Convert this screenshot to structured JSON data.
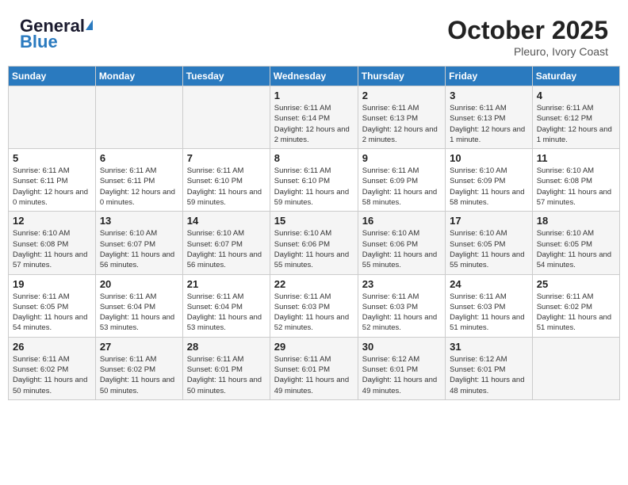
{
  "header": {
    "logo_general": "General",
    "logo_blue": "Blue",
    "month": "October 2025",
    "location": "Pleuro, Ivory Coast"
  },
  "weekdays": [
    "Sunday",
    "Monday",
    "Tuesday",
    "Wednesday",
    "Thursday",
    "Friday",
    "Saturday"
  ],
  "weeks": [
    [
      {
        "day": "",
        "info": ""
      },
      {
        "day": "",
        "info": ""
      },
      {
        "day": "",
        "info": ""
      },
      {
        "day": "1",
        "info": "Sunrise: 6:11 AM\nSunset: 6:14 PM\nDaylight: 12 hours and 2 minutes."
      },
      {
        "day": "2",
        "info": "Sunrise: 6:11 AM\nSunset: 6:13 PM\nDaylight: 12 hours and 2 minutes."
      },
      {
        "day": "3",
        "info": "Sunrise: 6:11 AM\nSunset: 6:13 PM\nDaylight: 12 hours and 1 minute."
      },
      {
        "day": "4",
        "info": "Sunrise: 6:11 AM\nSunset: 6:12 PM\nDaylight: 12 hours and 1 minute."
      }
    ],
    [
      {
        "day": "5",
        "info": "Sunrise: 6:11 AM\nSunset: 6:11 PM\nDaylight: 12 hours and 0 minutes."
      },
      {
        "day": "6",
        "info": "Sunrise: 6:11 AM\nSunset: 6:11 PM\nDaylight: 12 hours and 0 minutes."
      },
      {
        "day": "7",
        "info": "Sunrise: 6:11 AM\nSunset: 6:10 PM\nDaylight: 11 hours and 59 minutes."
      },
      {
        "day": "8",
        "info": "Sunrise: 6:11 AM\nSunset: 6:10 PM\nDaylight: 11 hours and 59 minutes."
      },
      {
        "day": "9",
        "info": "Sunrise: 6:11 AM\nSunset: 6:09 PM\nDaylight: 11 hours and 58 minutes."
      },
      {
        "day": "10",
        "info": "Sunrise: 6:10 AM\nSunset: 6:09 PM\nDaylight: 11 hours and 58 minutes."
      },
      {
        "day": "11",
        "info": "Sunrise: 6:10 AM\nSunset: 6:08 PM\nDaylight: 11 hours and 57 minutes."
      }
    ],
    [
      {
        "day": "12",
        "info": "Sunrise: 6:10 AM\nSunset: 6:08 PM\nDaylight: 11 hours and 57 minutes."
      },
      {
        "day": "13",
        "info": "Sunrise: 6:10 AM\nSunset: 6:07 PM\nDaylight: 11 hours and 56 minutes."
      },
      {
        "day": "14",
        "info": "Sunrise: 6:10 AM\nSunset: 6:07 PM\nDaylight: 11 hours and 56 minutes."
      },
      {
        "day": "15",
        "info": "Sunrise: 6:10 AM\nSunset: 6:06 PM\nDaylight: 11 hours and 55 minutes."
      },
      {
        "day": "16",
        "info": "Sunrise: 6:10 AM\nSunset: 6:06 PM\nDaylight: 11 hours and 55 minutes."
      },
      {
        "day": "17",
        "info": "Sunrise: 6:10 AM\nSunset: 6:05 PM\nDaylight: 11 hours and 55 minutes."
      },
      {
        "day": "18",
        "info": "Sunrise: 6:10 AM\nSunset: 6:05 PM\nDaylight: 11 hours and 54 minutes."
      }
    ],
    [
      {
        "day": "19",
        "info": "Sunrise: 6:11 AM\nSunset: 6:05 PM\nDaylight: 11 hours and 54 minutes."
      },
      {
        "day": "20",
        "info": "Sunrise: 6:11 AM\nSunset: 6:04 PM\nDaylight: 11 hours and 53 minutes."
      },
      {
        "day": "21",
        "info": "Sunrise: 6:11 AM\nSunset: 6:04 PM\nDaylight: 11 hours and 53 minutes."
      },
      {
        "day": "22",
        "info": "Sunrise: 6:11 AM\nSunset: 6:03 PM\nDaylight: 11 hours and 52 minutes."
      },
      {
        "day": "23",
        "info": "Sunrise: 6:11 AM\nSunset: 6:03 PM\nDaylight: 11 hours and 52 minutes."
      },
      {
        "day": "24",
        "info": "Sunrise: 6:11 AM\nSunset: 6:03 PM\nDaylight: 11 hours and 51 minutes."
      },
      {
        "day": "25",
        "info": "Sunrise: 6:11 AM\nSunset: 6:02 PM\nDaylight: 11 hours and 51 minutes."
      }
    ],
    [
      {
        "day": "26",
        "info": "Sunrise: 6:11 AM\nSunset: 6:02 PM\nDaylight: 11 hours and 50 minutes."
      },
      {
        "day": "27",
        "info": "Sunrise: 6:11 AM\nSunset: 6:02 PM\nDaylight: 11 hours and 50 minutes."
      },
      {
        "day": "28",
        "info": "Sunrise: 6:11 AM\nSunset: 6:01 PM\nDaylight: 11 hours and 50 minutes."
      },
      {
        "day": "29",
        "info": "Sunrise: 6:11 AM\nSunset: 6:01 PM\nDaylight: 11 hours and 49 minutes."
      },
      {
        "day": "30",
        "info": "Sunrise: 6:12 AM\nSunset: 6:01 PM\nDaylight: 11 hours and 49 minutes."
      },
      {
        "day": "31",
        "info": "Sunrise: 6:12 AM\nSunset: 6:01 PM\nDaylight: 11 hours and 48 minutes."
      },
      {
        "day": "",
        "info": ""
      }
    ]
  ]
}
